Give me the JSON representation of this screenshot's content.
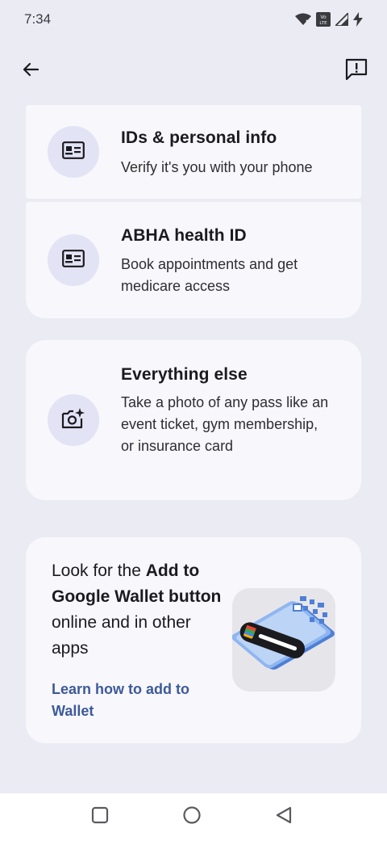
{
  "status_bar": {
    "time": "7:34",
    "icons": [
      "wifi-icon",
      "volte-icon",
      "signal-icon",
      "charging-icon"
    ]
  },
  "top_bar": {
    "back_icon": "arrow-back-icon",
    "feedback_icon": "feedback-icon"
  },
  "cards": [
    {
      "title": "IDs & personal info",
      "description": "Verify it's you with your phone",
      "icon": "id-card-icon"
    },
    {
      "title": "ABHA health ID",
      "description": "Book appointments and get medicare access",
      "icon": "id-card-icon"
    },
    {
      "title": "Everything else",
      "description": "Take a photo of any pass like an event ticket, gym membership, or insurance card",
      "icon": "camera-sparkle-icon"
    }
  ],
  "promo": {
    "text_part1": "Look for the ",
    "text_bold": "Add to Google Wallet button",
    "text_part2": " online and in other apps",
    "link": "Learn how to add to Wallet"
  },
  "nav_bar": {
    "icons": [
      "recents-square-icon",
      "home-circle-icon",
      "back-triangle-icon"
    ]
  },
  "colors": {
    "background": "#ebebf3",
    "card": "#f7f7fc",
    "icon_circle": "#e3e3f6",
    "link": "#3d5a98"
  }
}
